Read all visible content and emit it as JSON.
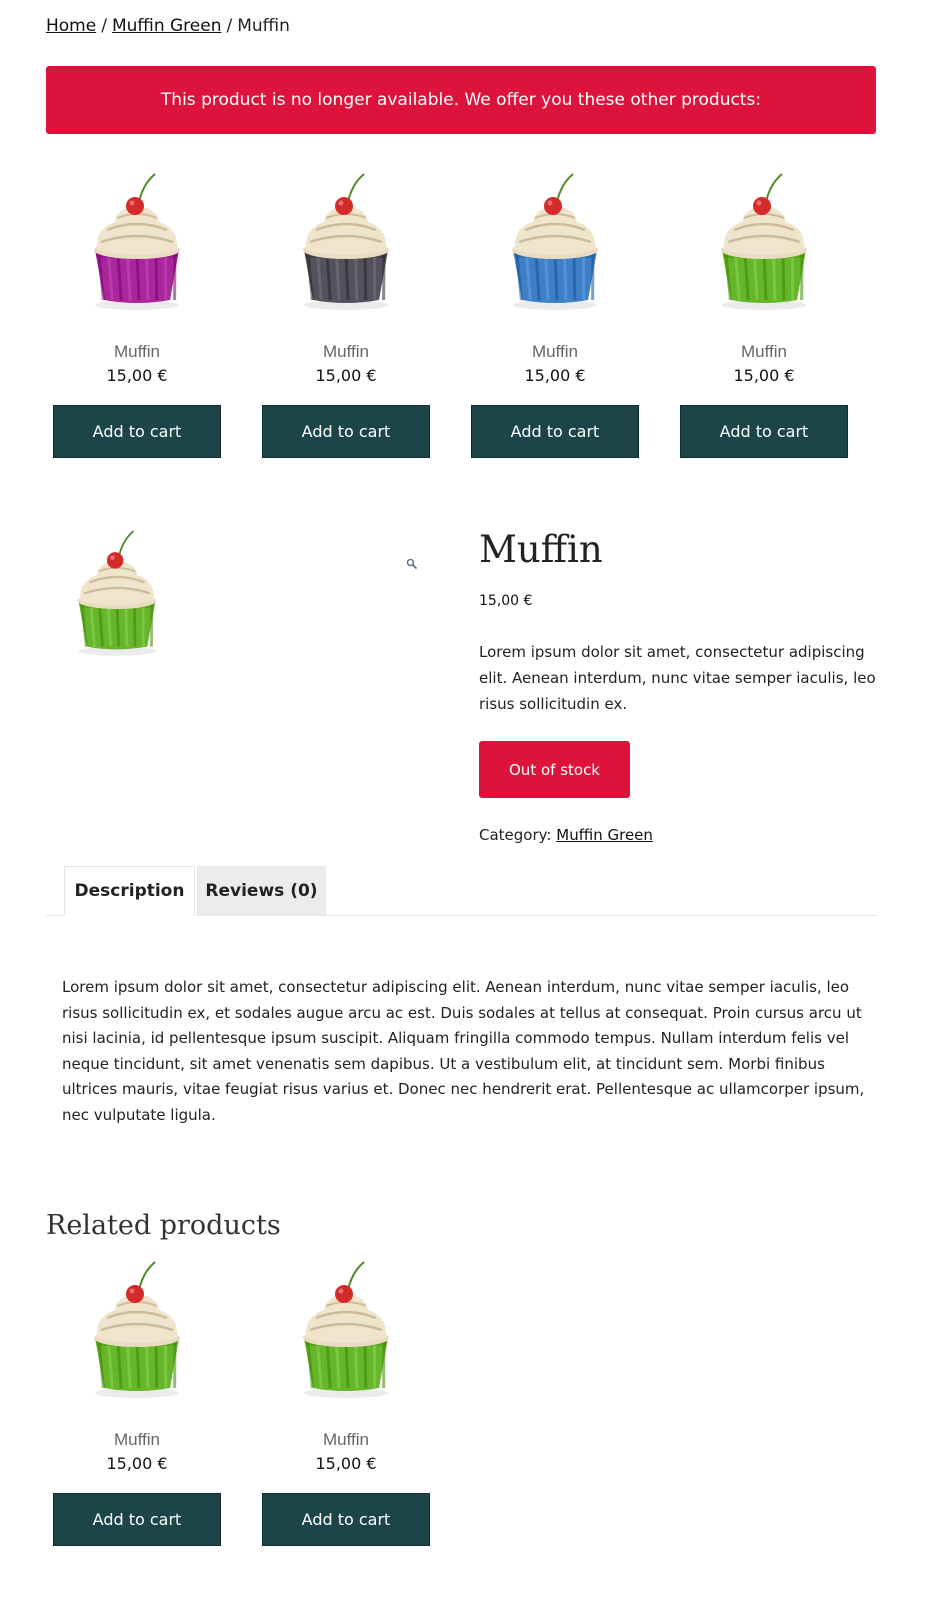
{
  "breadcrumb": {
    "home": "Home",
    "category": "Muffin Green",
    "current": "Muffin",
    "separator": "/"
  },
  "notice": "This product is no longer available. We offer you these other products:",
  "alternatives": [
    {
      "name": "Muffin",
      "price": "15,00 €",
      "button": "Add to cart",
      "cup_color": "#a8279a"
    },
    {
      "name": "Muffin",
      "price": "15,00 €",
      "button": "Add to cart",
      "cup_color": "#55515c"
    },
    {
      "name": "Muffin",
      "price": "15,00 €",
      "button": "Add to cart",
      "cup_color": "#3f7fc6"
    },
    {
      "name": "Muffin",
      "price": "15,00 €",
      "button": "Add to cart",
      "cup_color": "#67b52a"
    }
  ],
  "product": {
    "title": "Muffin",
    "price": "15,00 €",
    "short_description": "Lorem ipsum dolor sit amet, consectetur adipiscing elit. Aenean interdum, nunc vitae semper iaculis, leo risus sollicitudin ex.",
    "stock_status": "Out of stock",
    "category_label": "Category:",
    "category_link": "Muffin Green",
    "cup_color": "#67b52a"
  },
  "tabs": [
    {
      "label": "Description",
      "active": true
    },
    {
      "label": "Reviews (0)",
      "active": false
    }
  ],
  "description": "Lorem ipsum dolor sit amet, consectetur adipiscing elit. Aenean interdum, nunc vitae semper iaculis, leo risus sollicitudin ex, et sodales augue arcu ac est. Duis sodales at tellus at consequat. Proin cursus arcu ut nisi lacinia, id pellentesque ipsum suscipit. Aliquam fringilla commodo tempus. Nullam interdum felis vel neque tincidunt, sit amet venenatis sem dapibus. Ut a vestibulum elit, at tincidunt sem. Morbi finibus ultrices mauris, vitae feugiat risus varius et. Donec nec hendrerit erat. Pellentesque ac ullamcorper ipsum, nec vulputate ligula.",
  "related": {
    "title": "Related products",
    "items": [
      {
        "name": "Muffin",
        "price": "15,00 €",
        "button": "Add to cart",
        "cup_color": "#67b52a"
      },
      {
        "name": "Muffin",
        "price": "15,00 €",
        "button": "Add to cart",
        "cup_color": "#67b52a"
      }
    ]
  },
  "colors": {
    "notice_bg": "#dd133c",
    "button_bg": "#1d4549",
    "out_of_stock_bg": "#dd133c"
  }
}
